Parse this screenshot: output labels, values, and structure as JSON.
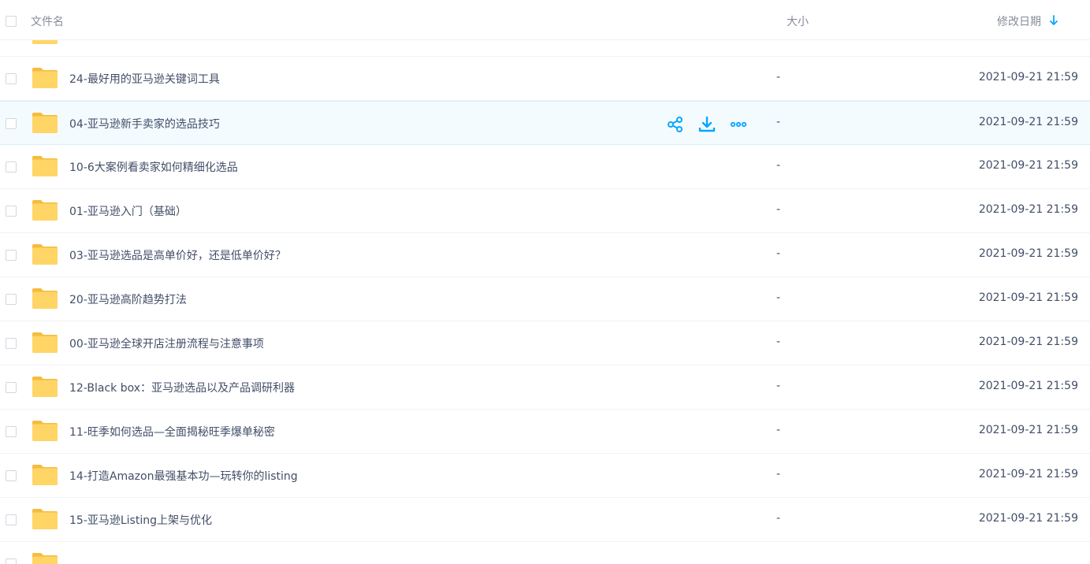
{
  "header": {
    "name_label": "文件名",
    "size_label": "大小",
    "date_label": "修改日期"
  },
  "colors": {
    "accent": "#06a7ff",
    "folder_body": "#ffd566",
    "folder_tab": "#f5bc3d"
  },
  "files": [
    {
      "name": "",
      "size": "",
      "date": ""
    },
    {
      "name": "24-最好用的亚马逊关键词工具",
      "size": "-",
      "date": "2021-09-21 21:59"
    },
    {
      "name": "04-亚马逊新手卖家的选品技巧",
      "size": "-",
      "date": "2021-09-21 21:59",
      "hovered": true
    },
    {
      "name": "10-6大案例看卖家如何精细化选品",
      "size": "-",
      "date": "2021-09-21 21:59"
    },
    {
      "name": "01-亚马逊入门（基础）",
      "size": "-",
      "date": "2021-09-21 21:59"
    },
    {
      "name": "03-亚马逊选品是高单价好，还是低单价好？",
      "size": "-",
      "date": "2021-09-21 21:59"
    },
    {
      "name": "20-亚马逊高阶趋势打法",
      "size": "-",
      "date": "2021-09-21 21:59"
    },
    {
      "name": "00-亚马逊全球开店注册流程与注意事项",
      "size": "-",
      "date": "2021-09-21 21:59"
    },
    {
      "name": "12-Black box：亚马逊选品以及产品调研利器",
      "size": "-",
      "date": "2021-09-21 21:59"
    },
    {
      "name": "11-旺季如何选品—全面揭秘旺季爆单秘密",
      "size": "-",
      "date": "2021-09-21 21:59"
    },
    {
      "name": "14-打造Amazon最强基本功—玩转你的listing",
      "size": "-",
      "date": "2021-09-21 21:59"
    },
    {
      "name": "15-亚马逊Listing上架与优化",
      "size": "-",
      "date": "2021-09-21 21:59"
    },
    {
      "name": "",
      "size": "",
      "date": ""
    }
  ],
  "row_actions": [
    {
      "icon": "share-icon"
    },
    {
      "icon": "download-icon"
    },
    {
      "icon": "more-icon"
    }
  ]
}
